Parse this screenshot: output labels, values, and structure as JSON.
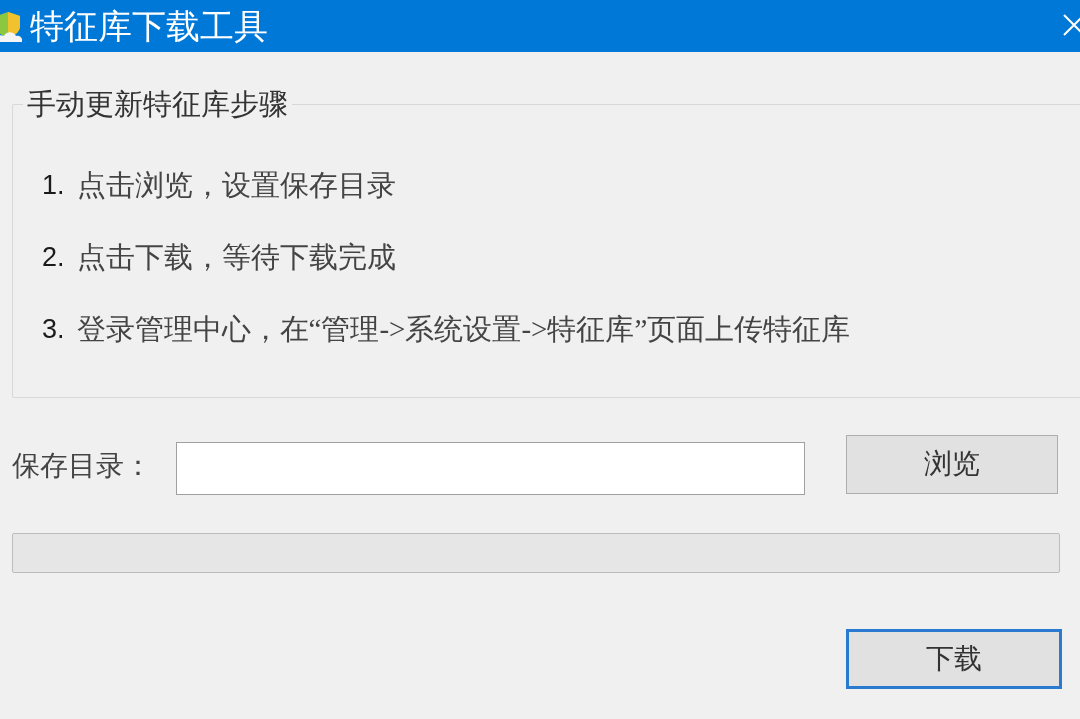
{
  "window": {
    "title": "特征库下载工具"
  },
  "steps_group": {
    "title": "手动更新特征库步骤",
    "steps": [
      {
        "number": "1.",
        "text": "点击浏览，设置保存目录"
      },
      {
        "number": "2.",
        "text": "点击下载，等待下载完成"
      },
      {
        "number": "3.",
        "text": "登录管理中心，在“管理->系统设置->特征库”页面上传特征库"
      }
    ]
  },
  "save_directory": {
    "label": "保存目录："
  },
  "browse_button": {
    "label": "浏览",
    "focused": false
  },
  "progress": {
    "level": 0
  },
  "download_button": {
    "label": "下载",
    "focused": true
  }
}
